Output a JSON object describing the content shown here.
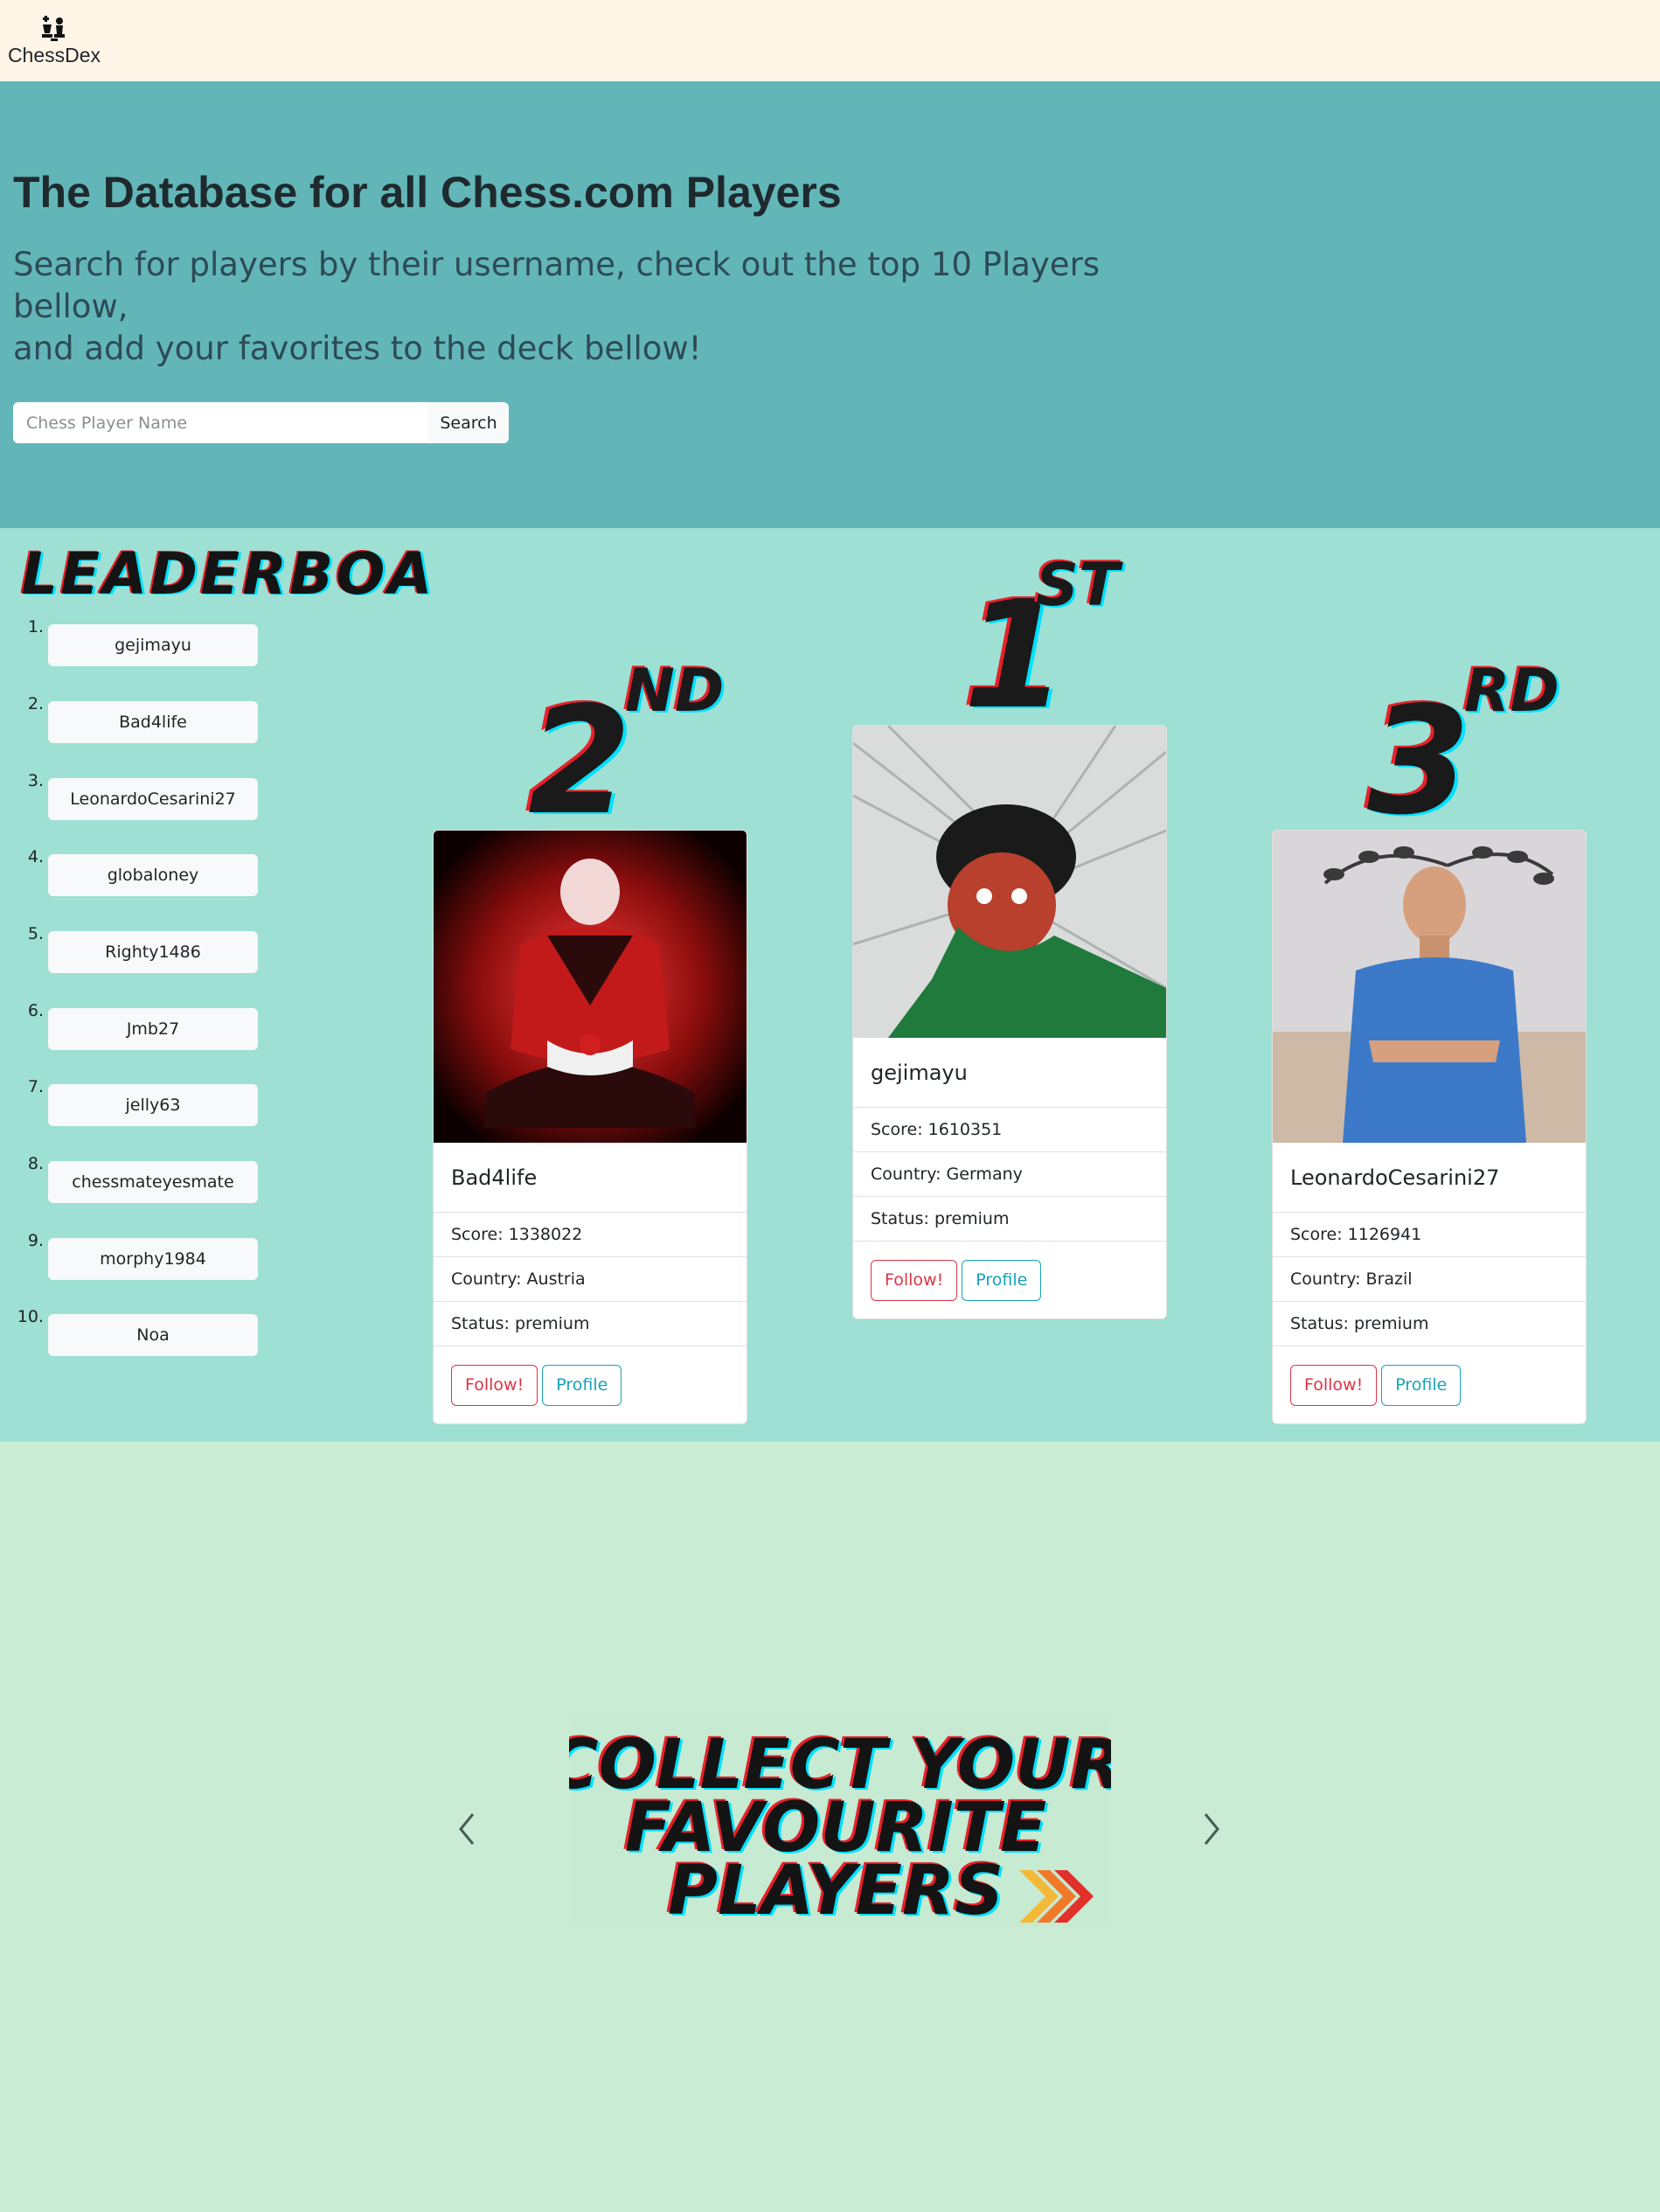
{
  "nav": {
    "brand": "ChessDex"
  },
  "hero": {
    "title": "The Database for all Chess.com Players",
    "subtitle_line1": "Search for players by their username, check out the top 10 Players bellow,",
    "subtitle_line2": "and add your favorites to the deck bellow!",
    "search_placeholder": "Chess Player Name",
    "search_button": "Search"
  },
  "leaderboard": {
    "heading": "LEADERBOARD",
    "items": [
      {
        "rank": "1.",
        "name": "gejimayu"
      },
      {
        "rank": "2.",
        "name": "Bad4life"
      },
      {
        "rank": "3.",
        "name": "LeonardoCesarini27"
      },
      {
        "rank": "4.",
        "name": "globaloney"
      },
      {
        "rank": "5.",
        "name": "Righty1486"
      },
      {
        "rank": "6.",
        "name": "Jmb27"
      },
      {
        "rank": "7.",
        "name": "jelly63"
      },
      {
        "rank": "8.",
        "name": "chessmateyesmate"
      },
      {
        "rank": "9.",
        "name": "morphy1984"
      },
      {
        "rank": "10.",
        "name": "Noa"
      }
    ]
  },
  "podium": {
    "first": {
      "place_num": "1",
      "place_suffix": "ST",
      "name": "gejimayu",
      "score": "Score: 1610351",
      "country": "Country: Germany",
      "status": "Status: premium",
      "follow": "Follow!",
      "profile": "Profile"
    },
    "second": {
      "place_num": "2",
      "place_suffix": "ND",
      "name": "Bad4life",
      "score": "Score: 1338022",
      "country": "Country: Austria",
      "status": "Status: premium",
      "follow": "Follow!",
      "profile": "Profile"
    },
    "third": {
      "place_num": "3",
      "place_suffix": "RD",
      "name": "LeonardoCesarini27",
      "score": "Score: 1126941",
      "country": "Country: Brazil",
      "status": "Status: premium",
      "follow": "Follow!",
      "profile": "Profile"
    }
  },
  "carousel": {
    "line1": "COLLECT YOUR",
    "line2": "FAVOURITE",
    "line3": "PLAYERS"
  },
  "colors": {
    "navbar": "#fff6e8",
    "hero": "#63b6b8",
    "leaderboard": "#9ee0d3",
    "collect": "#caecd5",
    "follow": "#dc3545",
    "profile": "#17a2b8"
  }
}
